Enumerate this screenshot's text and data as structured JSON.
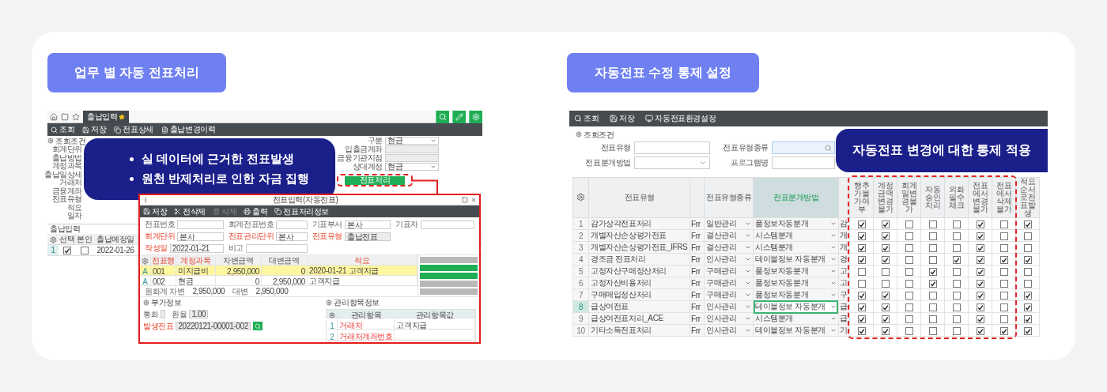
{
  "left_panel": {
    "heading": "업무 별 자동 전표처리",
    "app": {
      "tabs": [
        {
          "label": "출납입력",
          "selected": true
        }
      ],
      "toolbar": [
        "조회",
        "저장",
        "전표상세",
        "출납변경이력"
      ],
      "filter_title": "조회조건",
      "filter_labels": [
        "회계단위",
        "출납방법",
        "계정과목",
        "출납일상세",
        "거래처",
        "금융계좌",
        "전표유형",
        "적요",
        "일자"
      ],
      "right_fields": [
        {
          "label": "구분",
          "kind": "select",
          "value": "현금"
        },
        {
          "label": "입출금계좌",
          "kind": "text"
        },
        {
          "label": "금융기관지점",
          "kind": "text"
        },
        {
          "label": "상대계정",
          "kind": "select",
          "value": "현금"
        }
      ],
      "action_button": "전표처리",
      "grid": {
        "title": "출납입력",
        "columns": [
          "선택",
          "본인",
          "출납예정일"
        ],
        "rows": [
          {
            "number": "1",
            "picked": true,
            "own": false,
            "date": "2022-01-26"
          }
        ]
      }
    },
    "callout": [
      "실 데이터에 근거한 전표발생",
      "원천 반제처리로 인한 자금 집행"
    ],
    "dialog": {
      "title": "전표입력(자동전표)",
      "toolbar": [
        {
          "label": "저장",
          "disabled": false
        },
        {
          "label": "전삭제",
          "disabled": false
        },
        {
          "label": "삭제",
          "disabled": true
        },
        {
          "label": "출력",
          "disabled": false
        },
        {
          "label": "전표처리정보",
          "disabled": false
        }
      ],
      "field_rows": [
        [
          {
            "label": "전표번호",
            "required": false
          },
          {
            "label": "회계전표번호",
            "required": false
          },
          {
            "label": "기표부서",
            "value": "본사",
            "required": false
          },
          {
            "label": "기표자",
            "required": false
          }
        ],
        [
          {
            "label": "회계단위",
            "value": "본사",
            "required": true
          },
          {
            "label": "전표관리단위",
            "value": "본사",
            "required": true
          },
          {
            "label": "전표유형",
            "value": "출납전표",
            "required": true
          }
        ],
        [
          {
            "label": "작성일",
            "value": "2022-01-21",
            "required": true
          },
          {
            "label": "비고",
            "required": false
          }
        ]
      ],
      "grid": {
        "columns": [
          {
            "label": "전표행",
            "required": true
          },
          {
            "label": "계정과목",
            "required": true
          },
          {
            "label": "차변금액",
            "required": false
          },
          {
            "label": "대변금액",
            "required": false
          },
          {
            "label": "적요",
            "required": true
          }
        ],
        "rows": [
          {
            "status": "A",
            "line": "001",
            "account": "미지급비",
            "debit": "2,950,000",
            "credit": "0",
            "memo": "2020-01-21 고객지급",
            "selected": true
          },
          {
            "status": "A",
            "line": "002",
            "account": "현금",
            "debit": "0",
            "credit": "2,950,000",
            "memo": "고객지급",
            "selected": false
          }
        ]
      },
      "totals": [
        {
          "label": "원화계 차변",
          "value": "2,950,000"
        },
        {
          "label": "대변",
          "value": "2,950,000"
        }
      ],
      "side_buttons": [
        {
          "kind": "plain"
        },
        {
          "kind": "green"
        },
        {
          "kind": "green"
        },
        {
          "kind": "plain"
        },
        {
          "kind": "plain"
        }
      ],
      "detail": {
        "title": "부가정보",
        "fields": [
          {
            "label": "통화",
            "required": false
          },
          {
            "label": "환율",
            "value": "1.00",
            "required": false
          },
          {
            "label": "발생전표",
            "value": "20220121-00001-002",
            "required": true
          }
        ]
      },
      "items": {
        "title": "관리항목정보",
        "columns": [
          "관리항목",
          "관리항목값"
        ],
        "rows": [
          {
            "number": "1",
            "item": "거래처",
            "value": "고객지급"
          },
          {
            "number": "2",
            "item": "거래처계좌번호"
          }
        ]
      }
    }
  },
  "right_panel": {
    "heading": "자동전표 수정 통제 설정",
    "toolbar": [
      "조회",
      "저장",
      "자동전표환경설정"
    ],
    "filter": {
      "title": "조회조건",
      "fields": [
        {
          "label": "전표유형",
          "kind": "text"
        },
        {
          "label": "전표유형종류",
          "kind": "search"
        },
        {
          "label": "전표분개방법",
          "kind": "select"
        },
        {
          "label": "프로그램명",
          "kind": "text"
        }
      ]
    },
    "callout": "자동전표 변경에 대한 통제 적용",
    "table": {
      "columns": [
        {
          "label": "전표유형",
          "selected": false
        },
        {
          "label": "전표유형종류",
          "selected": false
        },
        {
          "label": "전표분개방법",
          "selected": true
        }
      ],
      "check_columns": [
        "행추가불가여부",
        "계정금액변경불가",
        "회계일변경불가",
        "자동승인처리",
        "외화필수체크",
        "전표에서변경불가",
        "전표에서삭제불가",
        "적요순서로전표발생"
      ],
      "rows": [
        {
          "number": "1",
          "type": "감가상각전표처리",
          "column_3": "Frr",
          "category": "일반관리",
          "method": "품정보자동분개",
          "column_6": "감",
          "checks": [
            true,
            true,
            false,
            false,
            false,
            true,
            false,
            true
          ],
          "selected": false
        },
        {
          "number": "2",
          "type": "개별자산손상평가전표",
          "column_3": "Frr",
          "category": "결산관리",
          "method": "시스템분개",
          "column_6": "개",
          "checks": [
            true,
            true,
            false,
            false,
            false,
            true,
            false,
            false
          ],
          "selected": false
        },
        {
          "number": "3",
          "type": "개별자산손상평가전표_IFRS",
          "column_3": "Frr",
          "category": "결산관리",
          "method": "시스템분개",
          "column_6": "개",
          "checks": [
            true,
            true,
            false,
            false,
            false,
            true,
            false,
            false
          ],
          "selected": false
        },
        {
          "number": "4",
          "type": "경조금 전표처리",
          "column_3": "Frr",
          "category": "인사관리",
          "method": "테이블정보 자동분개",
          "column_6": "경",
          "checks": [
            true,
            true,
            false,
            false,
            true,
            true,
            true,
            true
          ],
          "selected": false
        },
        {
          "number": "5",
          "type": "고정자산구매정산처리",
          "column_3": "Frr",
          "category": "구매관리",
          "method": "품정보자동분개",
          "column_6": "고",
          "checks": [
            false,
            false,
            false,
            true,
            false,
            true,
            false,
            false
          ],
          "selected": false
        },
        {
          "number": "6",
          "type": "고정자산비용처리",
          "column_3": "Frr",
          "category": "구매관리",
          "method": "품정보자동분개",
          "column_6": "고",
          "checks": [
            false,
            false,
            false,
            true,
            false,
            true,
            false,
            false
          ],
          "selected": false
        },
        {
          "number": "7",
          "type": "구매매입정산처리",
          "column_3": "Frr",
          "category": "구매관리",
          "method": "품정보자동분개",
          "column_6": "구",
          "checks": [
            true,
            true,
            false,
            false,
            false,
            true,
            false,
            true
          ],
          "selected": false
        },
        {
          "number": "8",
          "type": "급상여전표",
          "column_3": "Frr",
          "category": "인사관리",
          "method": "테이블정보 자동분개",
          "column_6": "급",
          "checks": [
            true,
            true,
            false,
            false,
            false,
            true,
            false,
            true
          ],
          "selected": true
        },
        {
          "number": "9",
          "type": "급상여전표처리_ACE",
          "column_3": "Frr",
          "category": "인사관리",
          "method": "시스템분개",
          "column_6": "급",
          "checks": [
            true,
            true,
            false,
            false,
            false,
            true,
            false,
            true
          ],
          "selected": false
        },
        {
          "number": "10",
          "type": "기타소득전표처리",
          "column_3": "Frr",
          "category": "인사관리",
          "method": "테이블정보 자동분개",
          "column_6": "기",
          "checks": [
            true,
            true,
            false,
            false,
            false,
            true,
            true,
            true
          ],
          "selected": false
        }
      ]
    }
  }
}
